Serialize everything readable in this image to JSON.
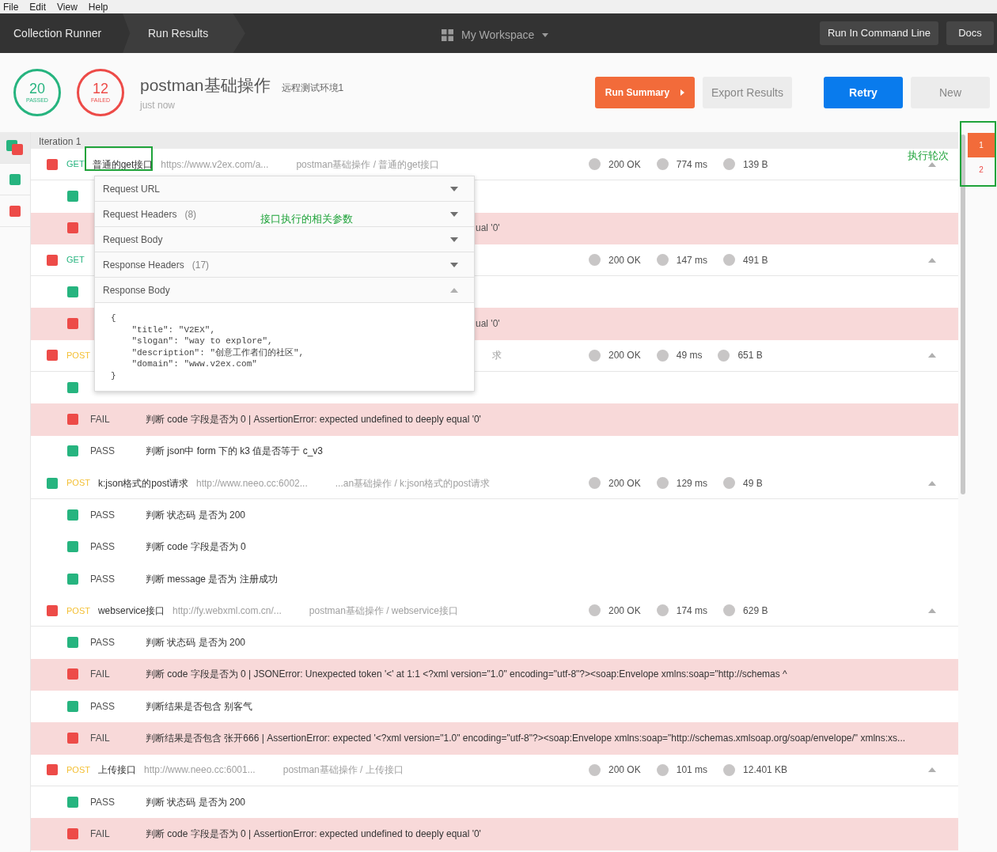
{
  "menu": [
    "File",
    "Edit",
    "View",
    "Help"
  ],
  "header": {
    "crumbs": [
      "Collection Runner",
      "Run Results"
    ],
    "workspace": "My Workspace",
    "buttons": [
      "Run In Command Line",
      "Docs"
    ]
  },
  "summary": {
    "passed": "20",
    "passed_label": "PASSED",
    "failed": "12",
    "failed_label": "FAILED",
    "title": "postman基础操作",
    "environment": "远程测试环境1",
    "time": "just now",
    "buttons": [
      "Run Summary",
      "Export Results",
      "Retry",
      "New"
    ]
  },
  "sidebar": [
    {
      "kind": "mixed",
      "selected": true
    },
    {
      "kind": "pass",
      "selected": false
    },
    {
      "kind": "fail",
      "selected": false
    }
  ],
  "iteration_label": "Iteration 1",
  "rows": [
    {
      "kind": "request",
      "passed": false,
      "method": "GET",
      "color": "#26b47f",
      "name": "普通的get接口",
      "url": "https://www.v2ex.com/a...",
      "path": "postman基础操作 / 普通的get接口",
      "status": "200 OK",
      "time": "774 ms",
      "size": "139 B",
      "expanded": true
    },
    {
      "kind": "test",
      "passed": true
    },
    {
      "kind": "test",
      "passed": false,
      "tail": "ual '0'"
    },
    {
      "kind": "request",
      "passed": false,
      "method": "GET",
      "color": "#26b47f",
      "status": "200 OK",
      "time": "147 ms",
      "size": "491 B",
      "expanded": true
    },
    {
      "kind": "test",
      "passed": true
    },
    {
      "kind": "test",
      "passed": false,
      "tail": "ual '0'"
    },
    {
      "kind": "request",
      "passed": false,
      "method": "POST",
      "color": "#f4c036",
      "tail": "求",
      "status": "200 OK",
      "time": "49 ms",
      "size": "651 B",
      "expanded": true
    },
    {
      "kind": "test",
      "passed": true
    },
    {
      "kind": "test",
      "passed": false,
      "status": "FAIL",
      "message": "判断 code 字段是否为 0 | AssertionError: expected undefined to deeply equal '0'"
    },
    {
      "kind": "test",
      "passed": true,
      "status": "PASS",
      "message": "判断 json中 form 下的 k3 值是否等于 c_v3"
    },
    {
      "kind": "request",
      "passed": true,
      "method": "POST",
      "color": "#f4c036",
      "name": "k:json格式的post请求",
      "url": "http://www.neeo.cc:6002...",
      "path": "...an基础操作 / k:json格式的post请求",
      "status": "200 OK",
      "time": "129 ms",
      "size": "49 B",
      "expanded": true
    },
    {
      "kind": "test",
      "passed": true,
      "status": "PASS",
      "message": "判断 状态码 是否为 200"
    },
    {
      "kind": "test",
      "passed": true,
      "status": "PASS",
      "message": "判断 code 字段是否为 0"
    },
    {
      "kind": "test",
      "passed": true,
      "status": "PASS",
      "message": "判断 message 是否为 注册成功"
    },
    {
      "kind": "request",
      "passed": false,
      "method": "POST",
      "color": "#f4c036",
      "name": "webservice接口",
      "url": "http://fy.webxml.com.cn/...",
      "path": "postman基础操作 / webservice接口",
      "status": "200 OK",
      "time": "174 ms",
      "size": "629 B",
      "expanded": true
    },
    {
      "kind": "test",
      "passed": true,
      "status": "PASS",
      "message": "判断 状态码 是否为 200"
    },
    {
      "kind": "test",
      "passed": false,
      "status": "FAIL",
      "message": "判断 code 字段是否为 0 | JSONError: Unexpected token '<' at 1:1 <?xml version=\"1.0\" encoding=\"utf-8\"?><soap:Envelope xmlns:soap=\"http://schemas ^"
    },
    {
      "kind": "test",
      "passed": true,
      "status": "PASS",
      "message": "判断结果是否包含 别客气"
    },
    {
      "kind": "test",
      "passed": false,
      "status": "FAIL",
      "message": "判断结果是否包含 张开666 | AssertionError: expected '<?xml version=\"1.0\" encoding=\"utf-8\"?><soap:Envelope xmlns:soap=\"http://schemas.xmlsoap.org/soap/envelope/\" xmlns:xs..."
    },
    {
      "kind": "request",
      "passed": false,
      "method": "POST",
      "color": "#f4c036",
      "name": "上传接口",
      "url": "http://www.neeo.cc:6001...",
      "path": "postman基础操作 / 上传接口",
      "status": "200 OK",
      "time": "101 ms",
      "size": "12.401 KB",
      "expanded": true
    },
    {
      "kind": "test",
      "passed": true,
      "status": "PASS",
      "message": "判断 状态码 是否为 200"
    },
    {
      "kind": "test",
      "passed": false,
      "status": "FAIL",
      "message": "判断 code 字段是否为 0 | AssertionError: expected undefined to deeply equal '0'"
    }
  ],
  "popup": {
    "sections": [
      {
        "label": "Request URL",
        "expanded": false
      },
      {
        "label": "Request Headers",
        "count": "(8)",
        "expanded": false
      },
      {
        "label": "Request Body",
        "expanded": false
      },
      {
        "label": "Response Headers",
        "count": "(17)",
        "expanded": false
      },
      {
        "label": "Response Body",
        "expanded": true
      }
    ],
    "body": [
      "{",
      "    \"title\": \"V2EX\",",
      "    \"slogan\": \"way to explore\",",
      "    \"description\": \"创意工作者们的社区\",",
      "    \"domain\": \"www.v2ex.com\"",
      "}"
    ]
  },
  "iterations": [
    {
      "label": "1",
      "selected": true,
      "passed": false
    },
    {
      "label": "2",
      "selected": false,
      "passed": false
    }
  ],
  "annotations": [
    "执行轮次",
    "接口执行的相关参数"
  ]
}
